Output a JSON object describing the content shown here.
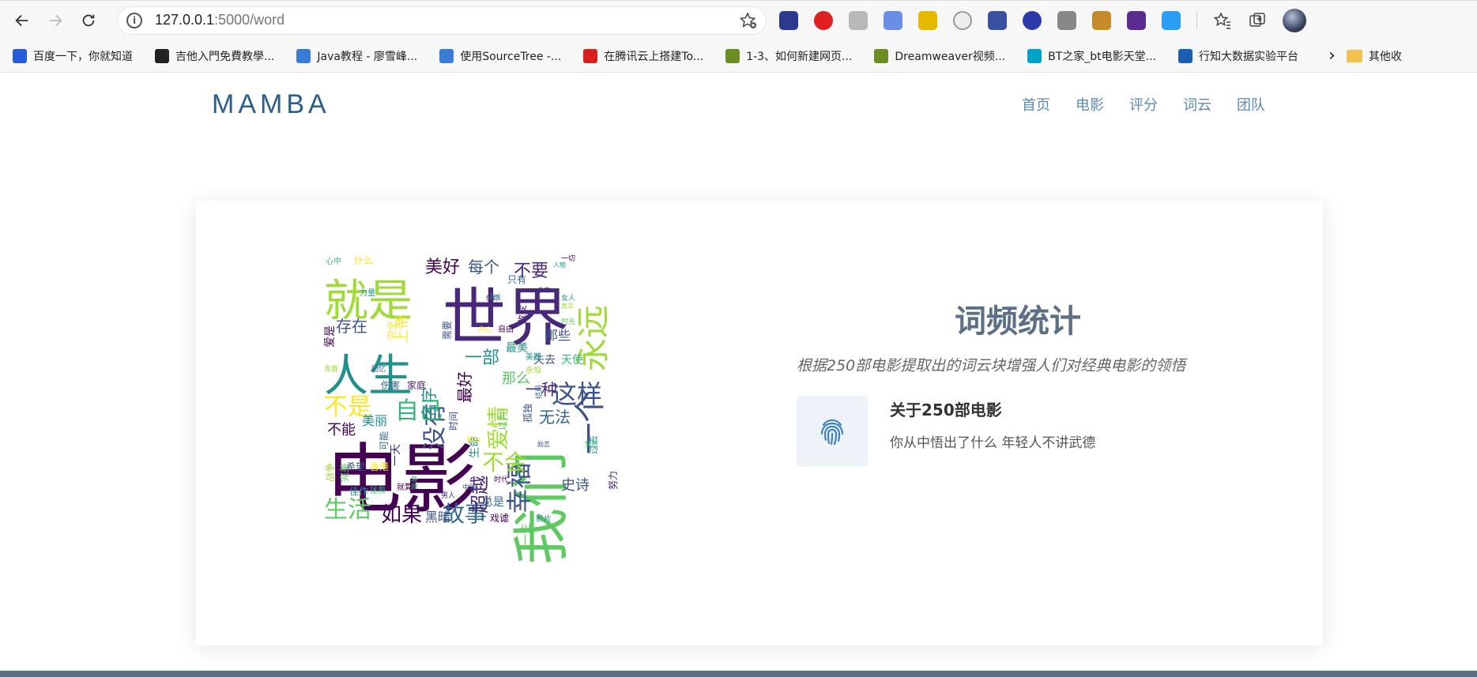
{
  "browser": {
    "url_host": "127.0.0.1",
    "url_rest": ":5000/word",
    "extensions": [
      "ext-1",
      "ext-2",
      "ext-3",
      "ext-4",
      "ext-5",
      "ext-6",
      "ext-7",
      "ext-8",
      "ext-9",
      "ext-10",
      "ext-11"
    ],
    "bookmarks": [
      {
        "label": "百度一下，你就知道",
        "color": "#2a5bd7"
      },
      {
        "label": "吉他入門免費教學...",
        "color": "#222222"
      },
      {
        "label": "Java教程 - 廖雪峰...",
        "color": "#3a7bd5"
      },
      {
        "label": "使用SourceTree -...",
        "color": "#3a7bd5"
      },
      {
        "label": "在腾讯云上搭建To...",
        "color": "#d62020"
      },
      {
        "label": "1-3、如何新建网页...",
        "color": "#6b8e23"
      },
      {
        "label": "Dreamweaver视频...",
        "color": "#6b8e23"
      },
      {
        "label": "BT之家_bt电影天堂...",
        "color": "#00a3c8"
      },
      {
        "label": "行知大数据实验平台",
        "color": "#1a5fb4"
      }
    ],
    "other_bookmarks": "其他收"
  },
  "site": {
    "logo": "MAMBA",
    "menu": [
      "首页",
      "电影",
      "评分",
      "词云",
      "团队"
    ]
  },
  "section": {
    "title": "词频统计",
    "subtitle": "根据250部电影提取出的词云块增强人们对经典电影的领悟",
    "feature_title": "关于250部电影",
    "feature_desc": "你从中悟出了什么 年轻人不讲武德"
  },
  "wordcloud": {
    "palette": [
      "#440154",
      "#3b528b",
      "#21918c",
      "#5ec962",
      "#a0da39",
      "#fde725",
      "#31688e",
      "#35b779"
    ],
    "words": [
      {
        "w": "电影",
        "c": "#440154",
        "s": 96,
        "rot": 0
      },
      {
        "w": "世界",
        "c": "#482878",
        "s": 80,
        "rot": 0
      },
      {
        "w": "我们",
        "c": "#5ec962",
        "s": 72,
        "rot": 90
      },
      {
        "w": "人生",
        "c": "#21918c",
        "s": 56,
        "rot": 0
      },
      {
        "w": "就是",
        "c": "#a0da39",
        "s": 56,
        "rot": 0
      },
      {
        "w": "永远",
        "c": "#a0da39",
        "s": 42,
        "rot": 90
      },
      {
        "w": "一个",
        "c": "#3b528b",
        "s": 40,
        "rot": 90
      },
      {
        "w": "这样",
        "c": "#3b528b",
        "s": 32,
        "rot": 0
      },
      {
        "w": "幸福",
        "c": "#3b528b",
        "s": 32,
        "rot": 90
      },
      {
        "w": "没有",
        "c": "#3b528b",
        "s": 30,
        "rot": 90
      },
      {
        "w": "不是",
        "c": "#fde725",
        "s": 30,
        "rot": 0
      },
      {
        "w": "生活",
        "c": "#5ec962",
        "s": 30,
        "rot": 0
      },
      {
        "w": "自己",
        "c": "#35b779",
        "s": 30,
        "rot": 0
      },
      {
        "w": "故事",
        "c": "#31688e",
        "s": 28,
        "rot": 0
      },
      {
        "w": "如果",
        "c": "#440154",
        "s": 26,
        "rot": 0
      },
      {
        "w": "爱情",
        "c": "#a0da39",
        "s": 28,
        "rot": 90
      },
      {
        "w": "不会",
        "c": "#a0da39",
        "s": 28,
        "rot": 0
      },
      {
        "w": "超越",
        "c": "#482878",
        "s": 24,
        "rot": 90
      },
      {
        "w": "美好",
        "c": "#440154",
        "s": 22,
        "rot": 0
      },
      {
        "w": "每个",
        "c": "#3b528b",
        "s": 20,
        "rot": 0
      },
      {
        "w": "不要",
        "c": "#482878",
        "s": 22,
        "rot": 0
      },
      {
        "w": "存在",
        "c": "#3b528b",
        "s": 20,
        "rot": 0
      },
      {
        "w": "一部",
        "c": "#21918c",
        "s": 22,
        "rot": 0
      },
      {
        "w": "名字",
        "c": "#21918c",
        "s": 20,
        "rot": 90
      },
      {
        "w": "无法",
        "c": "#31688e",
        "s": 20,
        "rot": 0
      },
      {
        "w": "一种",
        "c": "#482878",
        "s": 20,
        "rot": 0
      },
      {
        "w": "最好",
        "c": "#440154",
        "s": 20,
        "rot": 90
      },
      {
        "w": "史诗",
        "c": "#3b528b",
        "s": 18,
        "rot": 0
      },
      {
        "w": "美丽",
        "c": "#21918c",
        "s": 16,
        "rot": 0
      },
      {
        "w": "不能",
        "c": "#440154",
        "s": 18,
        "rot": 0
      },
      {
        "w": "黑暗",
        "c": "#3b528b",
        "s": 16,
        "rot": 0
      },
      {
        "w": "那么",
        "c": "#5ec962",
        "s": 18,
        "rot": 0
      },
      {
        "w": "那些",
        "c": "#3b528b",
        "s": 16,
        "rot": 0
      },
      {
        "w": "最美",
        "c": "#21918c",
        "s": 14,
        "rot": 0
      },
      {
        "w": "上帝",
        "c": "#fde725",
        "s": 18,
        "rot": 90
      },
      {
        "w": "天使",
        "c": "#35b779",
        "s": 14,
        "rot": 0
      },
      {
        "w": "失去",
        "c": "#3b528b",
        "s": 14,
        "rot": 0
      },
      {
        "w": "总是",
        "c": "#31688e",
        "s": 14,
        "rot": 0
      },
      {
        "w": "戏谑",
        "c": "#440154",
        "s": 12,
        "rot": 0
      },
      {
        "w": "一生",
        "c": "#5ec962",
        "s": 14,
        "rot": 90
      },
      {
        "w": "生命",
        "c": "#21918c",
        "s": 14,
        "rot": 90
      },
      {
        "w": "努力",
        "c": "#482878",
        "s": 12,
        "rot": 90
      },
      {
        "w": "香港",
        "c": "#fde725",
        "s": 12,
        "rot": 0
      },
      {
        "w": "希望",
        "c": "#3b528b",
        "s": 12,
        "rot": 0
      },
      {
        "w": "佳作",
        "c": "#21918c",
        "s": 12,
        "rot": 0
      },
      {
        "w": "伤害",
        "c": "#31688e",
        "s": 12,
        "rot": 0
      },
      {
        "w": "家庭",
        "c": "#482878",
        "s": 12,
        "rot": 0
      },
      {
        "w": "战争",
        "c": "#a0da39",
        "s": 12,
        "rot": 90
      },
      {
        "w": "完美",
        "c": "#5ec962",
        "s": 12,
        "rot": 90
      },
      {
        "w": "爱是",
        "c": "#440154",
        "s": 14,
        "rot": 90
      },
      {
        "w": "什么",
        "c": "#fde725",
        "s": 12,
        "rot": 0
      },
      {
        "w": "心中",
        "c": "#35b779",
        "s": 10,
        "rot": 0
      },
      {
        "w": "力量",
        "c": "#21918c",
        "s": 10,
        "rot": 0
      },
      {
        "w": "孤独",
        "c": "#3b528b",
        "s": 12,
        "rot": 90
      },
      {
        "w": "只有",
        "c": "#31688e",
        "s": 12,
        "rot": 0
      },
      {
        "w": "改变",
        "c": "#482878",
        "s": 12,
        "rot": 90
      },
      {
        "w": "美国",
        "c": "#21918c",
        "s": 10,
        "rot": 0
      },
      {
        "w": "永恒",
        "c": "#a0da39",
        "s": 10,
        "rot": 0
      },
      {
        "w": "时间",
        "c": "#3b528b",
        "s": 12,
        "rot": 90
      },
      {
        "w": "以为",
        "c": "#5ec962",
        "s": 12,
        "rot": 90
      },
      {
        "w": "自由",
        "c": "#440154",
        "s": 10,
        "rot": 0
      },
      {
        "w": "需要",
        "c": "#3b528b",
        "s": 12,
        "rot": 90
      },
      {
        "w": "过去",
        "c": "#21918c",
        "s": 12,
        "rot": 90
      },
      {
        "w": "一天",
        "c": "#482878",
        "s": 14,
        "rot": 90
      },
      {
        "w": "可能",
        "c": "#31688e",
        "s": 12,
        "rot": 90
      },
      {
        "w": "完全",
        "c": "#fde725",
        "s": 12,
        "rot": 90
      },
      {
        "w": "拯救",
        "c": "#35b779",
        "s": 10,
        "rot": 0
      },
      {
        "w": "就算",
        "c": "#440154",
        "s": 10,
        "rot": 0
      },
      {
        "w": "影片",
        "c": "#21918c",
        "s": 10,
        "rot": 0
      },
      {
        "w": "中国",
        "c": "#3b528b",
        "s": 9,
        "rot": 0
      },
      {
        "w": "时代",
        "c": "#440154",
        "s": 9,
        "rot": 0
      },
      {
        "w": "明白",
        "c": "#fde725",
        "s": 9,
        "rot": 0
      },
      {
        "w": "简单",
        "c": "#35b779",
        "s": 9,
        "rot": 90
      },
      {
        "w": "男人",
        "c": "#482878",
        "s": 9,
        "rot": 0
      },
      {
        "w": "女人",
        "c": "#21918c",
        "s": 9,
        "rot": 0
      },
      {
        "w": "青春",
        "c": "#a0da39",
        "s": 9,
        "rot": 0
      },
      {
        "w": "回忆",
        "c": "#3b528b",
        "s": 9,
        "rot": 0
      },
      {
        "w": "时光",
        "c": "#5ec962",
        "s": 9,
        "rot": 0
      },
      {
        "w": "结局",
        "c": "#31688e",
        "s": 9,
        "rot": 90
      },
      {
        "w": "内心",
        "c": "#fde725",
        "s": 9,
        "rot": 0
      },
      {
        "w": "一切",
        "c": "#440154",
        "s": 9,
        "rot": 0
      },
      {
        "w": "人物",
        "c": "#21918c",
        "s": 8,
        "rot": 0
      },
      {
        "w": "励志",
        "c": "#3b528b",
        "s": 8,
        "rot": 0
      },
      {
        "w": "梦想",
        "c": "#35b779",
        "s": 8,
        "rot": 0
      },
      {
        "w": "未来",
        "c": "#482878",
        "s": 8,
        "rot": 0
      },
      {
        "w": "真实",
        "c": "#a0da39",
        "s": 8,
        "rot": 0
      },
      {
        "w": "信仰",
        "c": "#440154",
        "s": 8,
        "rot": 0
      },
      {
        "w": "责任",
        "c": "#21918c",
        "s": 8,
        "rot": 0
      }
    ]
  },
  "colors": {
    "logo": "#2b5d8c",
    "menu": "#5c8aaf",
    "title": "#5b6f87",
    "footer": "#5b6f83"
  }
}
